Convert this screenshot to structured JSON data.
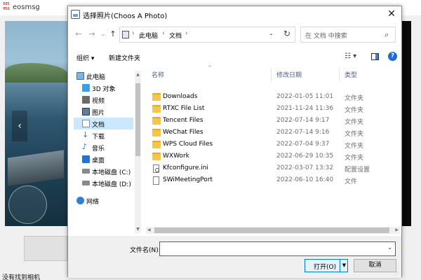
{
  "background_app": {
    "title": "eosmsg",
    "logo_lines": [
      "EOS",
      "MSG"
    ],
    "status_text": "没有找到相机"
  },
  "dialog": {
    "title": "选择照片(Choos A Photo)",
    "close_glyph": "✕",
    "nav": {
      "back": "←",
      "forward": "→",
      "recent": "⌄",
      "up": "↑"
    },
    "address": {
      "crumbs": [
        "此电脑",
        "文档"
      ],
      "separator": "›",
      "dropdown": "⌄",
      "refresh": "↻"
    },
    "search": {
      "placeholder": "在 文档 中搜索",
      "icon": "⌕"
    },
    "commands": {
      "organize": "组织 ▾",
      "new_folder": "新建文件夹",
      "view": "☷ ▾",
      "help": "?"
    },
    "nav_pane": {
      "items": [
        {
          "label": "此电脑",
          "icon": "computer-icon",
          "color": "#7fb2e5",
          "selected": false
        },
        {
          "label": "3D 对象",
          "icon": "cube-icon",
          "color": "#3aa0e8",
          "selected": false
        },
        {
          "label": "视频",
          "icon": "video-icon",
          "color": "#6b6b6b",
          "selected": false
        },
        {
          "label": "图片",
          "icon": "picture-icon",
          "color": "#5f7f9f",
          "selected": false
        },
        {
          "label": "文档",
          "icon": "document-icon",
          "color": "#8a8a8a",
          "selected": true
        },
        {
          "label": "下载",
          "icon": "download-icon",
          "color": "#1f74d1",
          "selected": false
        },
        {
          "label": "音乐",
          "icon": "music-icon",
          "color": "#1f74d1",
          "selected": false
        },
        {
          "label": "桌面",
          "icon": "desktop-icon",
          "color": "#1f74d1",
          "selected": false
        },
        {
          "label": "本地磁盘 (C:)",
          "icon": "drive-icon",
          "color": "#8a8a8a",
          "selected": false
        },
        {
          "label": "本地磁盘 (D:)",
          "icon": "drive-icon",
          "color": "#8a8a8a",
          "selected": false
        },
        {
          "label": "网络",
          "icon": "network-icon",
          "color": "#2f7fd6",
          "selected": false
        }
      ]
    },
    "file_list": {
      "columns": {
        "name": "名称",
        "date": "修改日期",
        "type": "类型",
        "sort_glyph": "^"
      },
      "rows": [
        {
          "name": "Downloads",
          "date": "2022-01-05 11:01",
          "type": "文件夹",
          "icon": "folder-icon"
        },
        {
          "name": "RTXC File List",
          "date": "2021-11-24 11:36",
          "type": "文件夹",
          "icon": "folder-icon"
        },
        {
          "name": "Tencent Files",
          "date": "2022-07-14 9:17",
          "type": "文件夹",
          "icon": "folder-icon"
        },
        {
          "name": "WeChat Files",
          "date": "2022-07-14 9:16",
          "type": "文件夹",
          "icon": "folder-icon"
        },
        {
          "name": "WPS Cloud Files",
          "date": "2022-07-04 9:37",
          "type": "文件夹",
          "icon": "folder-icon"
        },
        {
          "name": "WXWork",
          "date": "2022-06-29 10:35",
          "type": "文件夹",
          "icon": "folder-icon"
        },
        {
          "name": "Kfconfigure.ini",
          "date": "2022-03-07 13:32",
          "type": "配置设置",
          "icon": "config-file-icon"
        },
        {
          "name": "SWiMeetingPort",
          "date": "2022-06-10 16:40",
          "type": "文件",
          "icon": "file-icon"
        }
      ]
    },
    "filename": {
      "label": "文件名(N):",
      "value": "",
      "dropdown": "⌄"
    },
    "buttons": {
      "open": "打开(O)",
      "open_split": "▼",
      "cancel": "取消"
    }
  }
}
